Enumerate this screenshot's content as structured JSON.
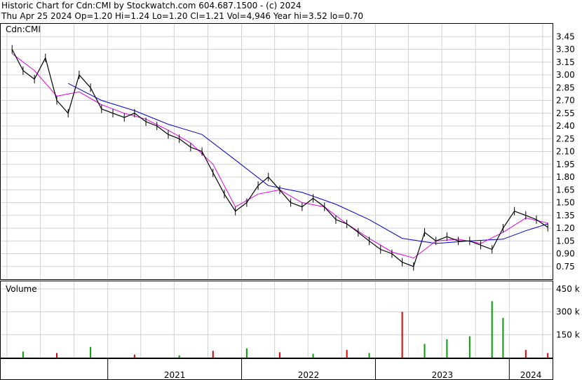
{
  "header": {
    "line1": "Historic Chart for Cdn:CMI by Stockwatch.com 604.687.1500 - (c) 2024",
    "line2": "Thu Apr 25 2024  Op=1.20  Hi=1.24  Lo=1.20  Cl=1.21  Vol=4,946  Year hi=3.52  lo=0.70"
  },
  "chart_data": [
    {
      "type": "ohlc",
      "title": "Cdn:CMI",
      "ylim": [
        0.6,
        3.6
      ],
      "y_ticks": [
        "3.45",
        "3.30",
        "3.15",
        "3.00",
        "2.85",
        "2.70",
        "2.55",
        "2.40",
        "2.25",
        "2.10",
        "1.95",
        "1.80",
        "1.65",
        "1.50",
        "1.35",
        "1.20",
        "1.05",
        "0.90",
        "0.75"
      ],
      "grid": true,
      "colors": {
        "price": "#000000",
        "ma_short": "#e600e6",
        "ma_long": "#0000cc",
        "grid": "#d0d0d0"
      },
      "price_points": [
        {
          "x": "2020-04",
          "y": 3.3
        },
        {
          "x": "2020-05",
          "y": 3.05
        },
        {
          "x": "2020-06",
          "y": 2.95
        },
        {
          "x": "2020-07",
          "y": 3.2
        },
        {
          "x": "2020-08",
          "y": 2.7
        },
        {
          "x": "2020-09",
          "y": 2.55
        },
        {
          "x": "2020-10",
          "y": 3.0
        },
        {
          "x": "2020-11",
          "y": 2.85
        },
        {
          "x": "2020-12",
          "y": 2.6
        },
        {
          "x": "2021-01",
          "y": 2.55
        },
        {
          "x": "2021-02",
          "y": 2.5
        },
        {
          "x": "2021-03",
          "y": 2.55
        },
        {
          "x": "2021-04",
          "y": 2.45
        },
        {
          "x": "2021-05",
          "y": 2.4
        },
        {
          "x": "2021-06",
          "y": 2.3
        },
        {
          "x": "2021-07",
          "y": 2.25
        },
        {
          "x": "2021-08",
          "y": 2.15
        },
        {
          "x": "2021-09",
          "y": 2.1
        },
        {
          "x": "2021-10",
          "y": 1.85
        },
        {
          "x": "2021-11",
          "y": 1.6
        },
        {
          "x": "2021-12",
          "y": 1.4
        },
        {
          "x": "2022-01",
          "y": 1.5
        },
        {
          "x": "2022-02",
          "y": 1.7
        },
        {
          "x": "2022-03",
          "y": 1.8
        },
        {
          "x": "2022-04",
          "y": 1.65
        },
        {
          "x": "2022-05",
          "y": 1.5
        },
        {
          "x": "2022-06",
          "y": 1.45
        },
        {
          "x": "2022-07",
          "y": 1.55
        },
        {
          "x": "2022-08",
          "y": 1.45
        },
        {
          "x": "2022-09",
          "y": 1.3
        },
        {
          "x": "2022-10",
          "y": 1.25
        },
        {
          "x": "2022-11",
          "y": 1.15
        },
        {
          "x": "2022-12",
          "y": 1.05
        },
        {
          "x": "2023-01",
          "y": 0.95
        },
        {
          "x": "2023-02",
          "y": 0.9
        },
        {
          "x": "2023-03",
          "y": 0.8
        },
        {
          "x": "2023-04",
          "y": 0.75
        },
        {
          "x": "2023-05",
          "y": 1.15
        },
        {
          "x": "2023-06",
          "y": 1.05
        },
        {
          "x": "2023-07",
          "y": 1.1
        },
        {
          "x": "2023-08",
          "y": 1.05
        },
        {
          "x": "2023-09",
          "y": 1.05
        },
        {
          "x": "2023-10",
          "y": 1.0
        },
        {
          "x": "2023-11",
          "y": 0.95
        },
        {
          "x": "2023-12",
          "y": 1.2
        },
        {
          "x": "2024-01",
          "y": 1.4
        },
        {
          "x": "2024-02",
          "y": 1.35
        },
        {
          "x": "2024-03",
          "y": 1.3
        },
        {
          "x": "2024-04",
          "y": 1.21
        }
      ],
      "ma_short": [
        {
          "x": "2020-04",
          "y": 3.25
        },
        {
          "x": "2020-06",
          "y": 3.05
        },
        {
          "x": "2020-08",
          "y": 2.75
        },
        {
          "x": "2020-10",
          "y": 2.8
        },
        {
          "x": "2020-12",
          "y": 2.65
        },
        {
          "x": "2021-02",
          "y": 2.55
        },
        {
          "x": "2021-04",
          "y": 2.48
        },
        {
          "x": "2021-06",
          "y": 2.35
        },
        {
          "x": "2021-08",
          "y": 2.2
        },
        {
          "x": "2021-10",
          "y": 1.95
        },
        {
          "x": "2021-12",
          "y": 1.45
        },
        {
          "x": "2022-02",
          "y": 1.6
        },
        {
          "x": "2022-04",
          "y": 1.65
        },
        {
          "x": "2022-06",
          "y": 1.5
        },
        {
          "x": "2022-08",
          "y": 1.45
        },
        {
          "x": "2022-10",
          "y": 1.25
        },
        {
          "x": "2022-12",
          "y": 1.08
        },
        {
          "x": "2023-02",
          "y": 0.92
        },
        {
          "x": "2023-04",
          "y": 0.85
        },
        {
          "x": "2023-06",
          "y": 1.05
        },
        {
          "x": "2023-08",
          "y": 1.07
        },
        {
          "x": "2023-10",
          "y": 1.02
        },
        {
          "x": "2023-12",
          "y": 1.15
        },
        {
          "x": "2024-02",
          "y": 1.32
        },
        {
          "x": "2024-04",
          "y": 1.26
        }
      ],
      "ma_long": [
        {
          "x": "2020-09",
          "y": 2.9
        },
        {
          "x": "2020-12",
          "y": 2.7
        },
        {
          "x": "2021-03",
          "y": 2.58
        },
        {
          "x": "2021-06",
          "y": 2.42
        },
        {
          "x": "2021-09",
          "y": 2.3
        },
        {
          "x": "2021-12",
          "y": 2.0
        },
        {
          "x": "2022-03",
          "y": 1.7
        },
        {
          "x": "2022-06",
          "y": 1.62
        },
        {
          "x": "2022-09",
          "y": 1.48
        },
        {
          "x": "2022-12",
          "y": 1.3
        },
        {
          "x": "2023-03",
          "y": 1.08
        },
        {
          "x": "2023-06",
          "y": 1.02
        },
        {
          "x": "2023-09",
          "y": 1.05
        },
        {
          "x": "2023-12",
          "y": 1.07
        },
        {
          "x": "2024-02",
          "y": 1.17
        },
        {
          "x": "2024-04",
          "y": 1.25
        }
      ]
    },
    {
      "type": "bar",
      "title": "Volume",
      "ylim": [
        0,
        500
      ],
      "y_ticks": [
        "450 k",
        "300 k",
        "150 k"
      ],
      "colors": {
        "up": "#00a000",
        "down": "#e00000"
      },
      "bars": [
        {
          "x": "2020-05",
          "v": 40,
          "up": true
        },
        {
          "x": "2020-08",
          "v": 30,
          "up": false
        },
        {
          "x": "2020-11",
          "v": 70,
          "up": true
        },
        {
          "x": "2021-03",
          "v": 20,
          "up": false
        },
        {
          "x": "2021-07",
          "v": 15,
          "up": true
        },
        {
          "x": "2021-10",
          "v": 45,
          "up": false
        },
        {
          "x": "2022-01",
          "v": 60,
          "up": true
        },
        {
          "x": "2022-04",
          "v": 35,
          "up": false
        },
        {
          "x": "2022-07",
          "v": 25,
          "up": true
        },
        {
          "x": "2022-10",
          "v": 50,
          "up": false
        },
        {
          "x": "2022-12",
          "v": 30,
          "up": true
        },
        {
          "x": "2023-03",
          "v": 300,
          "up": false
        },
        {
          "x": "2023-05",
          "v": 90,
          "up": true
        },
        {
          "x": "2023-07",
          "v": 120,
          "up": true
        },
        {
          "x": "2023-09",
          "v": 140,
          "up": true
        },
        {
          "x": "2023-11",
          "v": 370,
          "up": true
        },
        {
          "x": "2023-12",
          "v": 260,
          "up": true
        },
        {
          "x": "2024-02",
          "v": 50,
          "up": false
        },
        {
          "x": "2024-04",
          "v": 30,
          "up": false
        }
      ]
    }
  ],
  "x_axis": {
    "years": [
      "2021",
      "2022",
      "2023",
      "2024"
    ]
  }
}
